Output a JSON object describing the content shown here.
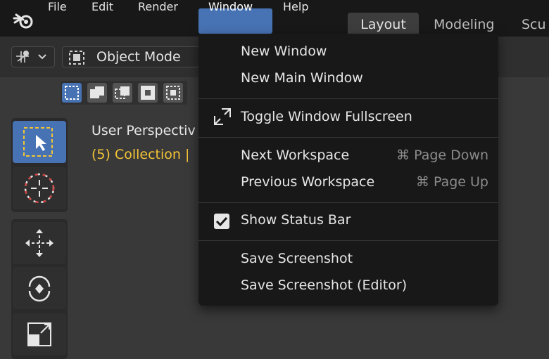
{
  "topbar": {
    "menus": [
      "File",
      "Edit",
      "Render",
      "Window",
      "Help"
    ],
    "tabs": [
      "Layout",
      "Modeling",
      "Scu"
    ]
  },
  "header": {
    "mode_label": "Object Mode"
  },
  "overlay": {
    "perspective": "User Perspectiv",
    "collection": "(5) Collection |"
  },
  "window_menu": {
    "items": [
      {
        "label": "New Window",
        "shortcut": ""
      },
      {
        "label": "New Main Window",
        "shortcut": ""
      },
      {
        "label": "Toggle Window Fullscreen",
        "shortcut": ""
      },
      {
        "label": "Next Workspace",
        "shortcut": "⌘ Page Down"
      },
      {
        "label": "Previous Workspace",
        "shortcut": "⌘ Page Up"
      },
      {
        "label": "Show Status Bar",
        "shortcut": ""
      },
      {
        "label": "Save Screenshot",
        "shortcut": ""
      },
      {
        "label": "Save Screenshot (Editor)",
        "shortcut": ""
      }
    ],
    "show_status_bar_checked": true
  },
  "colors": {
    "accent": "#4772b3",
    "menu_bg": "#181818",
    "collection_text": "#f3c437"
  }
}
